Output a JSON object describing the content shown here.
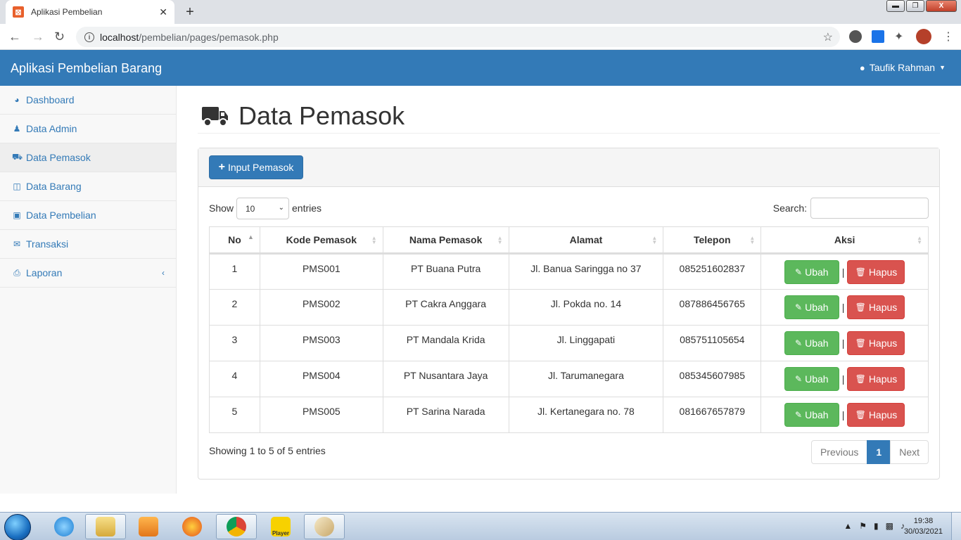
{
  "browser": {
    "tab_title": "Aplikasi Pembelian",
    "url_host": "localhost",
    "url_path": "/pembelian/pages/pemasok.php"
  },
  "navbar": {
    "brand": "Aplikasi Pembelian Barang",
    "user": "Taufik Rahman"
  },
  "sidebar": {
    "items": [
      {
        "label": "Dashboard",
        "icon": "dashboard-icon"
      },
      {
        "label": "Data Admin",
        "icon": "user-icon"
      },
      {
        "label": "Data Pemasok",
        "icon": "truck-icon"
      },
      {
        "label": "Data Barang",
        "icon": "briefcase-icon"
      },
      {
        "label": "Data Pembelian",
        "icon": "money-icon"
      },
      {
        "label": "Transaksi",
        "icon": "comments-icon"
      },
      {
        "label": "Laporan",
        "icon": "print-icon"
      }
    ]
  },
  "page": {
    "title": "Data Pemasok",
    "input_button": "Input Pemasok",
    "show_label": "Show",
    "length_value": "10",
    "entries_label": "entries",
    "search_label": "Search:"
  },
  "table": {
    "headers": [
      "No",
      "Kode Pemasok",
      "Nama Pemasok",
      "Alamat",
      "Telepon",
      "Aksi"
    ],
    "rows": [
      [
        "1",
        "PMS001",
        "PT Buana Putra",
        "Jl. Banua Saringga no 37",
        "085251602837"
      ],
      [
        "2",
        "PMS002",
        "PT Cakra Anggara",
        "Jl. Pokda no. 14",
        "087886456765"
      ],
      [
        "3",
        "PMS003",
        "PT Mandala Krida",
        "Jl. Linggapati",
        "085751105654"
      ],
      [
        "4",
        "PMS004",
        "PT Nusantara Jaya",
        "Jl. Tarumanegara",
        "085345607985"
      ],
      [
        "5",
        "PMS005",
        "PT Sarina Narada",
        "Jl. Kertanegara no. 78",
        "081667657879"
      ]
    ],
    "edit_label": "Ubah",
    "delete_label": "Hapus",
    "separator": "|"
  },
  "footer": {
    "info": "Showing 1 to 5 of 5 entries",
    "previous": "Previous",
    "page": "1",
    "next": "Next"
  },
  "taskbar": {
    "time": "19:38",
    "date": "30/03/2021",
    "player_label": "Player"
  },
  "colors": {
    "primary": "#337ab7",
    "success": "#5cb85c",
    "danger": "#d9534f"
  }
}
